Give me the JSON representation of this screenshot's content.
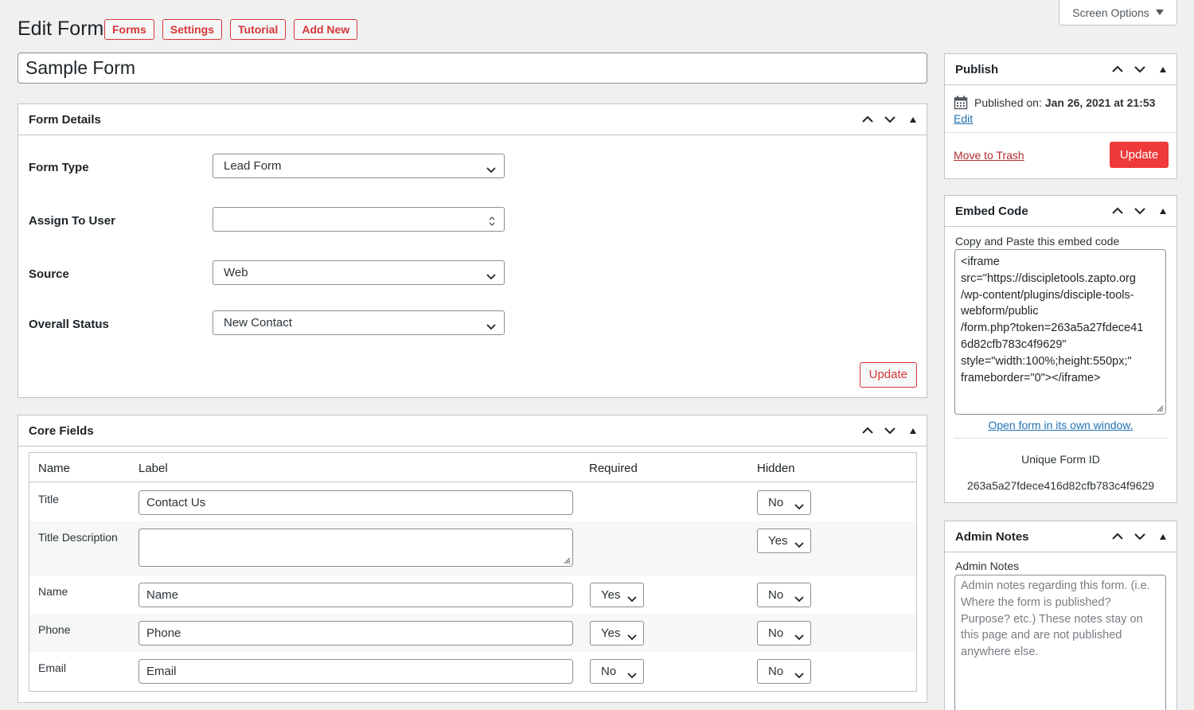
{
  "header": {
    "title": "Edit Form",
    "actions": [
      "Forms",
      "Settings",
      "Tutorial",
      "Add New"
    ],
    "screen_options": "Screen Options"
  },
  "form_name": "Sample Form",
  "form_details": {
    "title": "Form Details",
    "fields": [
      {
        "label": "Form Type",
        "value": "Lead Form"
      },
      {
        "label": "Assign To User",
        "value": ""
      },
      {
        "label": "Source",
        "value": "Web"
      },
      {
        "label": "Overall Status",
        "value": "New Contact"
      }
    ],
    "update_label": "Update"
  },
  "core_fields": {
    "title": "Core Fields",
    "columns": [
      "Name",
      "Label",
      "Required",
      "Hidden"
    ],
    "rows": [
      {
        "name": "Title",
        "label": "Contact Us",
        "required": "",
        "hidden": "No"
      },
      {
        "name": "Title Description",
        "label": "",
        "required": "",
        "hidden": "Yes"
      },
      {
        "name": "Name",
        "label": "Name",
        "required": "Yes",
        "hidden": "No"
      },
      {
        "name": "Phone",
        "label": "Phone",
        "required": "Yes",
        "hidden": "No"
      },
      {
        "name": "Email",
        "label": "Email",
        "required": "No",
        "hidden": "No"
      }
    ]
  },
  "publish": {
    "title": "Publish",
    "published_label": "Published on:",
    "published_date": "Jan 26, 2021 at 21:53",
    "edit_label": "Edit",
    "trash_label": "Move to Trash",
    "update_label": "Update"
  },
  "embed": {
    "title": "Embed Code",
    "instruction": "Copy and Paste this embed code",
    "code_lines": [
      "<iframe",
      "src=\"https://discipletools.zapto.org",
      "/wp-content/plugins/disciple-tools-",
      "webform/public",
      "/form.php?token=263a5a27fdece41",
      "6d82cfb783c4f9629\"",
      "style=\"width:100%;height:550px;\"",
      "frameborder=\"0\"></iframe>"
    ],
    "open_link": "Open form in its own window.",
    "unique_id_label": "Unique Form ID",
    "unique_id": "263a5a27fdece416d82cfb783c4f9629"
  },
  "admin_notes": {
    "title": "Admin Notes",
    "label": "Admin Notes",
    "placeholder": "Admin notes regarding this form. (i.e. Where the form is published? Purpose? etc.) These notes stay on this page and are not published anywhere else."
  },
  "colors": {
    "accent_red": "#d63638",
    "button_red": "#ee3a3a",
    "link_blue": "#2271b1",
    "background": "#f0f0f1"
  }
}
